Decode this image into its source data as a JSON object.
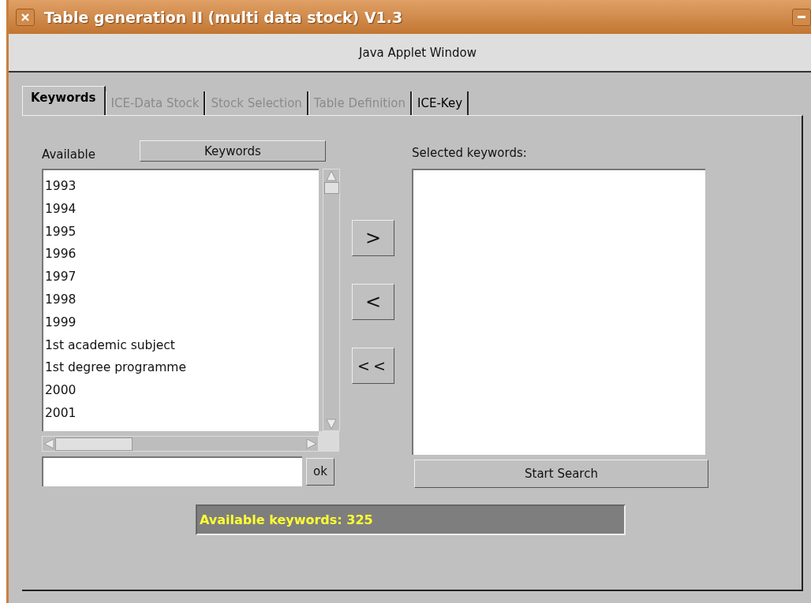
{
  "window": {
    "title": "Table generation II (multi data stock) V1.3",
    "applet_label": "Java Applet Window"
  },
  "tabs": [
    {
      "label": "Keywords",
      "selected": true,
      "disabled": false
    },
    {
      "label": "ICE-Data Stock",
      "selected": false,
      "disabled": true
    },
    {
      "label": "Stock Selection",
      "selected": false,
      "disabled": true
    },
    {
      "label": "Table Definition",
      "selected": false,
      "disabled": true
    },
    {
      "label": "ICE-Key",
      "selected": false,
      "disabled": false
    }
  ],
  "available": {
    "label": "Available",
    "sort_button": "Keywords",
    "items": [
      "1993",
      "1994",
      "1995",
      "1996",
      "1997",
      "1998",
      "1999",
      "1st academic subject",
      "1st degree programme",
      "2000",
      "2001"
    ],
    "ok_button": "ok"
  },
  "transfer_buttons": [
    ">",
    "<",
    "<<"
  ],
  "selected_keywords": {
    "label": "Selected keywords:",
    "start_button": "Start Search"
  },
  "status": "Available keywords: 325"
}
